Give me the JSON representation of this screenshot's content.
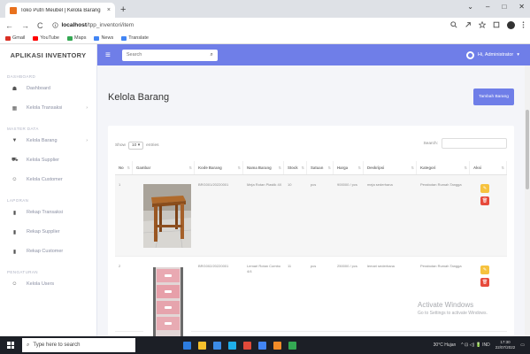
{
  "browser": {
    "tab_title": "Toko Putri Meubel | Kelola Barang",
    "tab_close": "×",
    "new_tab": "+",
    "url_host": "localhost",
    "url_path": "/tpp_inventori/item",
    "nav_back": "←",
    "nav_forward": "→",
    "nav_reload": "C",
    "win_min": "⌄",
    "win_restore": "–",
    "win_max": "□",
    "win_close": "✕",
    "bookmarks": [
      {
        "label": "Gmail",
        "color": "#d93025"
      },
      {
        "label": "YouTube",
        "color": "#ff0000"
      },
      {
        "label": "Maps",
        "color": "#34a853"
      },
      {
        "label": "News",
        "color": "#4285f4"
      },
      {
        "label": "Translate",
        "color": "#4285f4"
      }
    ]
  },
  "sidebar": {
    "brand": "APLIKASI INVENTORY",
    "sections": [
      {
        "heading": "DASHBOARD",
        "items": [
          {
            "label": "Dashboard",
            "icon": "☗"
          },
          {
            "label": "Kelola Transaksi",
            "icon": "▦",
            "chevron": "›"
          }
        ]
      },
      {
        "heading": "MASTER DATA",
        "items": [
          {
            "label": "Kelola Barang",
            "icon": "▼",
            "chevron": "›"
          },
          {
            "label": "Kelola Supplier",
            "icon": "⛟"
          },
          {
            "label": "Kelola Customer",
            "icon": "☺"
          }
        ]
      },
      {
        "heading": "LAPORAN",
        "items": [
          {
            "label": "Rekap Transaksi",
            "icon": "▮"
          },
          {
            "label": "Rekap Supplier",
            "icon": "▮"
          },
          {
            "label": "Rekap Customer",
            "icon": "▮"
          }
        ]
      },
      {
        "heading": "PENGATURAN",
        "items": [
          {
            "label": "Kelola Users",
            "icon": "☺"
          }
        ]
      }
    ]
  },
  "topnav": {
    "menu_icon": "≡",
    "search_placeholder": "Search",
    "search_icon": "⌕",
    "user_name": "Hi, Administrator",
    "user_caret": "▾"
  },
  "main": {
    "title": "Kelola Barang",
    "add_button": "Tambah Barang",
    "show_label": "Show",
    "show_value": "10",
    "show_caret": "▾",
    "entries_label": "entries",
    "search_label": "Search:",
    "columns": [
      "No",
      "Gambar",
      "Kode Barang",
      "Nama Barang",
      "Stock",
      "Satuan",
      "Harga",
      "Deskripsi",
      "Kategori",
      "Aksi"
    ],
    "sort_glyph": "⇅",
    "edit_glyph": "✎",
    "delete_glyph": "🗑",
    "rows": [
      {
        "no": "1",
        "kode": "BRG001/20220001",
        "nama": "Meja Rotan Plastik 4X",
        "stock": "10",
        "satuan": "pcs",
        "harga": "900000 / pcs",
        "deskripsi": "meja sederhana",
        "kategori": "Perabotan Rumah Tangga"
      },
      {
        "no": "2",
        "kode": "BRG002/20220001",
        "nama": "Lemari Rotan Combo 4/4",
        "stock": "11",
        "satuan": "pcs",
        "harga": "250000 / pcs",
        "deskripsi": "lemari sederhana",
        "kategori": "Perabotan Rumah Tangga"
      }
    ]
  },
  "watermark": {
    "line1": "Activate Windows",
    "line2": "Go to Settings to activate Windows."
  },
  "taskbar": {
    "search_placeholder": "Type here to search",
    "search_icon": "⌕",
    "apps": [
      "#2d7de0",
      "#f5c02c",
      "#3c8ce7",
      "#1faee9",
      "#e04a3a",
      "#4285f4",
      "#f28c28",
      "#34a853"
    ],
    "weather": "30°C Hujan",
    "tray_icons": "^ ⊡ ◁) 🔋 IND",
    "time": "17:30",
    "date": "22/07/2022",
    "notification": "▭"
  }
}
